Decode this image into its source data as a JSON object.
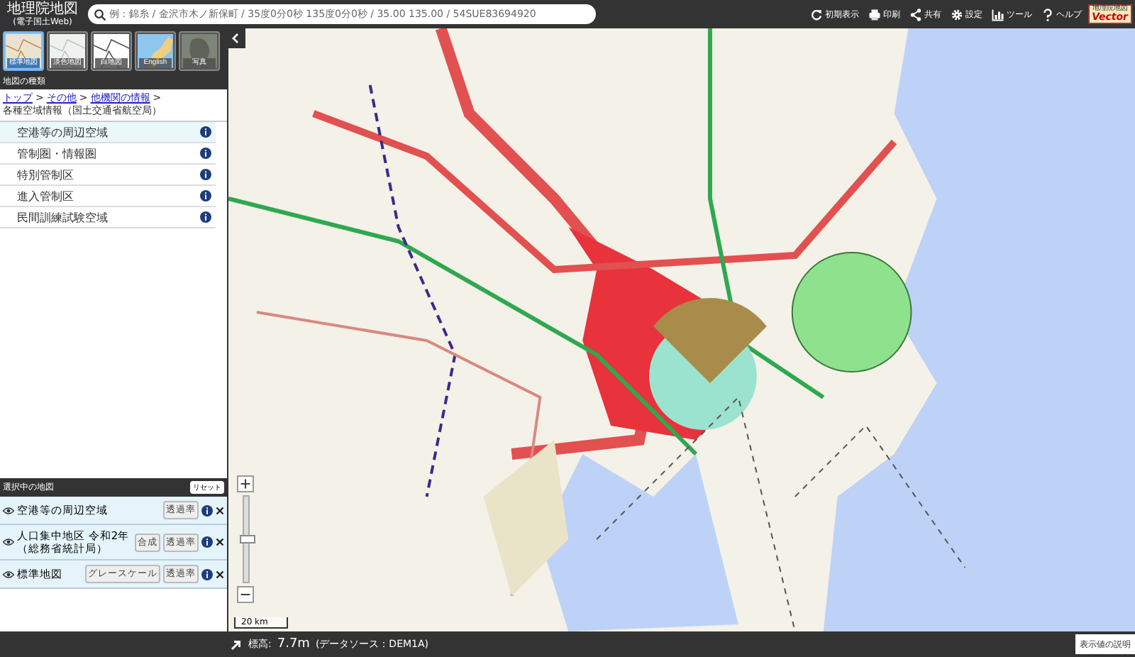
{
  "header": {
    "title": "地理院地図",
    "subtitle": "(電子国土Web)",
    "search": {
      "placeholder": "例：錦糸 / 金沢市木ノ新保町 / 35度0分0秒 135度0分0秒 / 35.00 135.00 / 54SUE83694920"
    },
    "tools": [
      {
        "kind": "reset",
        "label": "初期表示"
      },
      {
        "kind": "print",
        "label": "印刷"
      },
      {
        "kind": "share",
        "label": "共有"
      },
      {
        "kind": "settings",
        "label": "設定"
      },
      {
        "kind": "tool",
        "label": "ツール"
      },
      {
        "kind": "help",
        "label": "ヘルプ"
      }
    ],
    "logo": {
      "top": "地理院地図",
      "bottom": "Vector"
    }
  },
  "basemaps": [
    {
      "label": "標準地図",
      "kind": "standard",
      "selected": true
    },
    {
      "label": "淡色地図",
      "kind": "pale",
      "selected": false
    },
    {
      "label": "白地図",
      "kind": "blank",
      "selected": false
    },
    {
      "label": "English",
      "kind": "english",
      "selected": false
    },
    {
      "label": "写真",
      "selected": false
    }
  ],
  "map_types": {
    "title": "地図の種類",
    "breadcrumb": {
      "separator": ">",
      "links": [
        "トップ",
        "その他",
        "他機関の情報"
      ],
      "current": "各種空域情報（国土交通省航空局）"
    },
    "items": [
      {
        "label": "空港等の周辺空域",
        "selected": true
      },
      {
        "label": "管制圏・情報圏",
        "selected": false
      },
      {
        "label": "特別管制区",
        "selected": false
      },
      {
        "label": "進入管制区",
        "selected": false
      },
      {
        "label": "民間訓練試験空域",
        "selected": false
      }
    ]
  },
  "selected_layers": {
    "title": "選択中の地図",
    "reset": "リセット",
    "layers": [
      {
        "name": "空港等の周辺空域",
        "buttons": [
          "透過率"
        ]
      },
      {
        "name": "人口集中地区 令和2年（総務省統計局）",
        "buttons": [
          "合成",
          "透過率"
        ]
      },
      {
        "name": "標準地図",
        "buttons": [
          "グレースケール",
          "透過率"
        ]
      }
    ]
  },
  "map": {
    "scale": "20 km",
    "zoom": {
      "level": 0.5
    }
  },
  "status_bar": {
    "label": "標高:",
    "value": "7.7m",
    "source": "(データソース：DEM1A)",
    "button": "表示値の説明"
  }
}
